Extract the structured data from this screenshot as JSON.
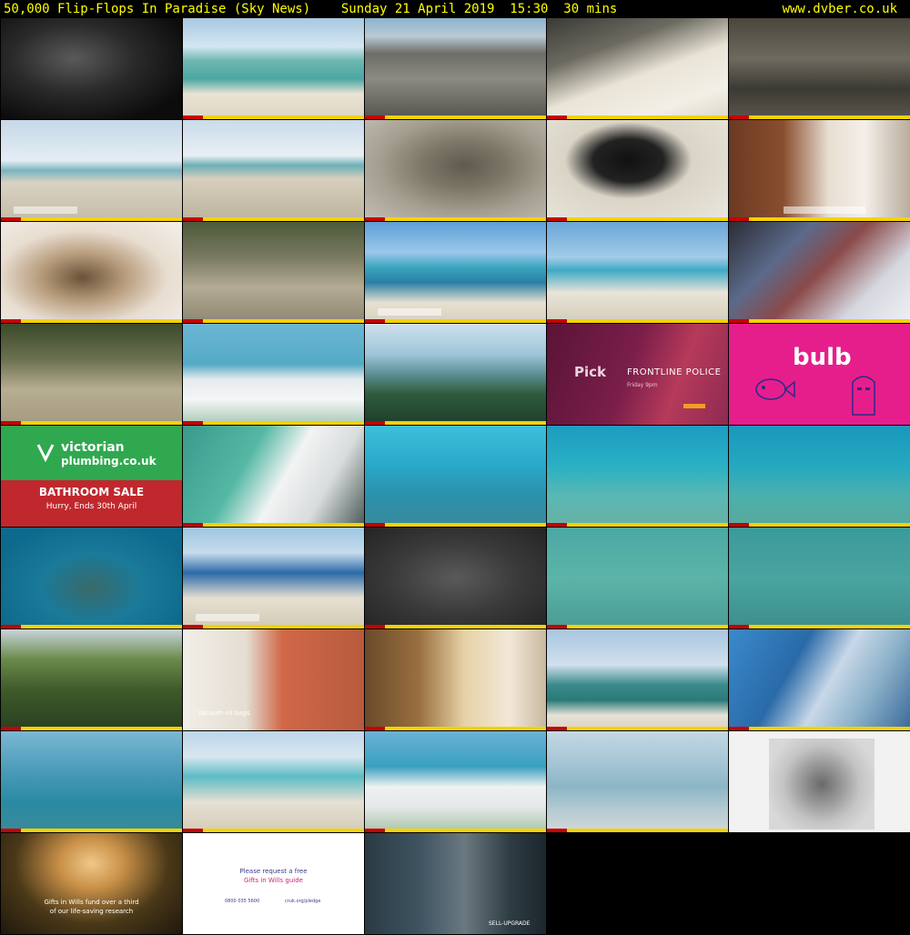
{
  "header": {
    "title": "50,000 Flip-Flops In Paradise (Sky News)    Sunday 21 April 2019  15:30  30 mins",
    "site": "www.dvber.co.uk"
  },
  "tiles": {
    "pick": {
      "brand": "Pick",
      "show": "FRONTLINE POLICE",
      "time": "Friday 9pm"
    },
    "bulb": {
      "brand": "bulb"
    },
    "vp": {
      "brand_line1": "victorian",
      "brand_line2": "plumbing.co.uk",
      "sale": "BATHROOM SALE",
      "sub": "Hurry, Ends 30th April"
    },
    "vacuum": {
      "caption": "Vacuum oil bags"
    },
    "gifts": {
      "line1": "Gifts in Wills fund over a third",
      "line2": "of our life-saving research"
    },
    "request": {
      "line1": "Please request a free",
      "line2": "Gifts in Wills guide",
      "phone": "0800 035 5600",
      "url": "cruk.org/pledge"
    },
    "upgrade": {
      "caption": "SELL-UPGRADE"
    }
  },
  "colors": {
    "header_text": "#ffff00",
    "ticker": "#f3d300",
    "pick_bg": "#7a1e4a",
    "bulb_bg": "#e61e8c",
    "vp_green": "#2fa84f",
    "vp_red": "#c0282d"
  }
}
